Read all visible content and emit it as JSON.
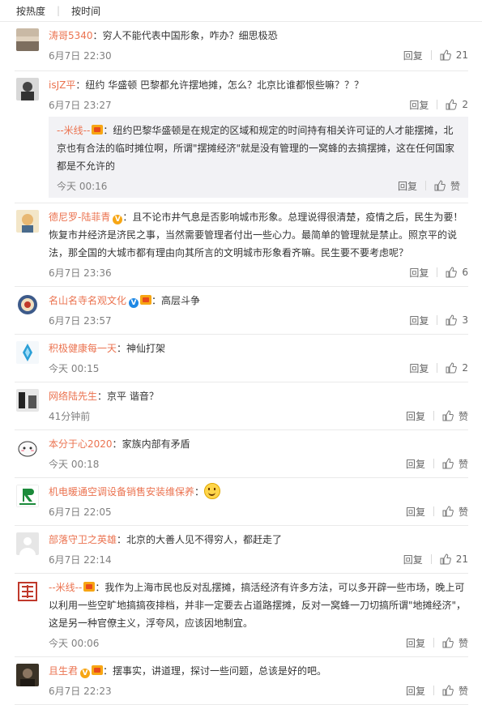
{
  "sort": {
    "hot": "按热度",
    "time": "按时间"
  },
  "actions": {
    "reply": "回复",
    "like_empty": "赞"
  },
  "comments": [
    {
      "user": "涛哥5340",
      "text": "穷人不能代表中国形象，咋办？细思极恐",
      "time": "6月7日 22:30",
      "likes": "21"
    },
    {
      "user": "isJZ平",
      "text": "纽约 华盛顿 巴黎都允许摆地摊，怎么？北京比谁都恨些嘛？？？",
      "time": "6月7日 23:27",
      "likes": "2",
      "sub": {
        "user": "--米线--",
        "text": "纽约巴黎华盛顿是在规定的区域和规定的时间持有相关许可证的人才能摆摊，北京也有合法的临时摊位啊，所谓\"摆摊经济\"就是没有管理的一窝蜂的去搞摆摊，这在任何国家都是不允许的",
        "time": "今天 00:16",
        "likes": "赞"
      }
    },
    {
      "user": "德尼罗-陆菲青",
      "text": "且不论市井气息是否影响城市形象。总理说得很清楚，疫情之后，民生为要！恢复市井经济是济民之事，当然需要管理者付出一些心力。最简单的管理就是禁止。照京平的说法，那全国的大城市都有理由向其所言的文明城市形象看齐嘛。民生要不要考虑呢？",
      "time": "6月7日 23:36",
      "likes": "6"
    },
    {
      "user": "名山名寺名观文化",
      "text": "高层斗争",
      "time": "6月7日 23:57",
      "likes": "3"
    },
    {
      "user": "积极健康每一天",
      "text": "神仙打架",
      "time": "今天 00:15",
      "likes": "2"
    },
    {
      "user": "网络陆先生",
      "text": "京平 谐音？",
      "time": "41分钟前",
      "likes": "赞"
    },
    {
      "user": "本分于心2020",
      "text": "家族内部有矛盾",
      "time": "今天 00:18",
      "likes": "赞"
    },
    {
      "user": "机电暖通空调设备销售安装维保养",
      "text": "",
      "time": "6月7日 22:05",
      "likes": "赞"
    },
    {
      "user": "部落守卫之英雄",
      "text": "北京的大善人见不得穷人，都赶走了",
      "time": "6月7日 22:14",
      "likes": "21"
    },
    {
      "user": "--米线--",
      "text": "我作为上海市民也反对乱摆摊，搞活经济有许多方法，可以多开辟一些市场，晚上可以利用一些空旷地搞搞夜排档，并非一定要去占道路摆摊，反对一窝蜂一刀切搞所谓\"地摊经济\"，这是另一种官僚主义，浮夸风，应该因地制宜。",
      "time": "今天 00:06",
      "likes": "赞"
    },
    {
      "user": "且生君",
      "text": "摆事实，讲道理，探讨一些问题，总该是好的吧。",
      "time": "6月7日 22:23",
      "likes": "赞"
    }
  ],
  "colors": {
    "username": "#eb7350",
    "time": "#808080",
    "sub_bg": "#f2f2f5",
    "vip_gold": "#f7a614",
    "verified_orange": "#f7a614",
    "verified_blue": "#1e88e5"
  }
}
